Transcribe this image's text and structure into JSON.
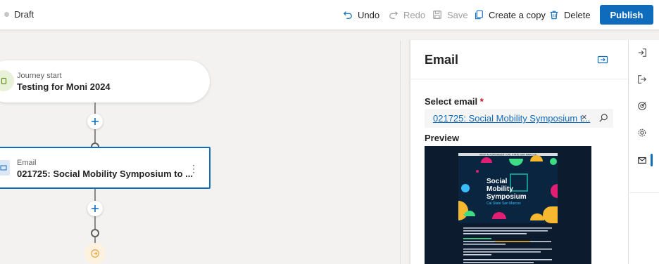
{
  "toolbar": {
    "status": "Draft",
    "undo": "Undo",
    "redo": "Redo",
    "save": "Save",
    "create_copy": "Create a copy",
    "delete": "Delete",
    "publish": "Publish"
  },
  "canvas": {
    "start_node": {
      "label": "Journey start",
      "title": "Testing for Moni 2024"
    },
    "email_node": {
      "label": "Email",
      "title": "021725: Social Mobility Symposium to ..."
    }
  },
  "panel": {
    "title": "Email",
    "select_label": "Select email",
    "required_mark": "*",
    "selected_email": "021725: Social Mobility Symposium t...",
    "clear": "×",
    "preview_label": "Preview"
  },
  "preview_email": {
    "top_banner": "VIEW IN A BROWSER  |  CAL STATE SAN MARCOS",
    "headline_line1": "Social",
    "headline_line2": "Mobility",
    "headline_line3": "Symposium",
    "subhead": "Cal State San Marcos",
    "colors": {
      "bg": "#0d1b2e",
      "teal": "#14b8a6",
      "pink": "#e11d74",
      "yellow": "#f5b82e",
      "green": "#3ddc84",
      "blue": "#38bdf8"
    }
  },
  "icons": {
    "undo": "undo-icon",
    "redo": "redo-icon",
    "save": "save-icon",
    "copy": "copy-icon",
    "delete": "delete-icon",
    "expand": "expand-panel-icon",
    "search": "search-icon",
    "rail": [
      "enter-icon",
      "exit-icon",
      "goal-icon",
      "settings-icon",
      "mail-icon"
    ]
  }
}
